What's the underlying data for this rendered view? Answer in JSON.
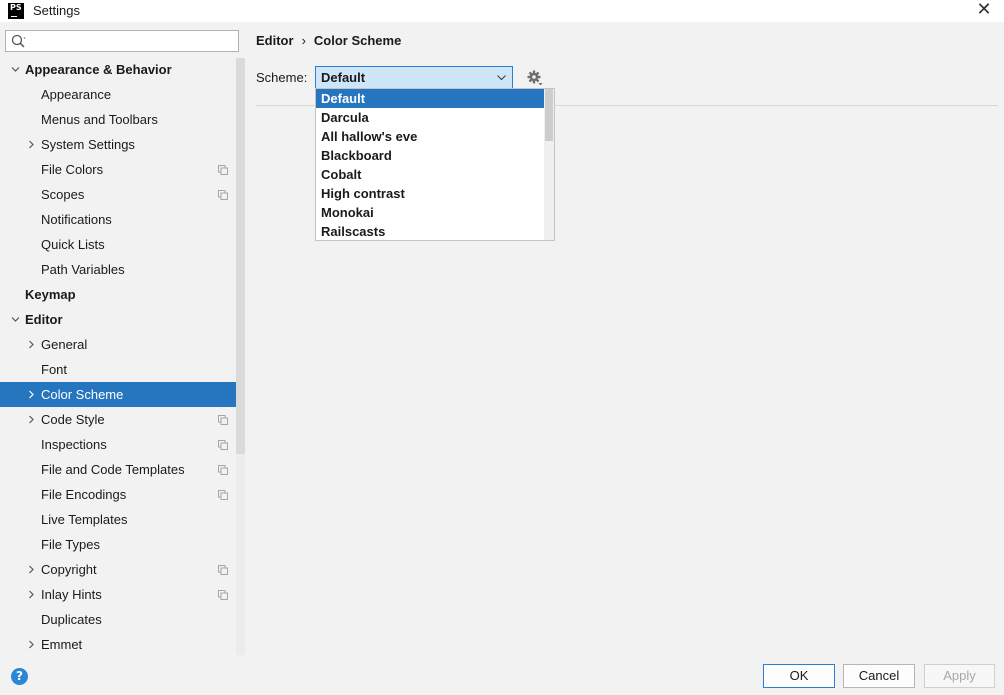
{
  "window": {
    "title": "Settings",
    "app_icon_text": "PS",
    "close_glyph": "✕"
  },
  "search": {
    "placeholder": "",
    "value": ""
  },
  "tree": [
    {
      "label": "Appearance & Behavior",
      "level": 0,
      "chevron": "down",
      "copy": false
    },
    {
      "label": "Appearance",
      "level": 1,
      "chevron": "",
      "copy": false
    },
    {
      "label": "Menus and Toolbars",
      "level": 1,
      "chevron": "",
      "copy": false
    },
    {
      "label": "System Settings",
      "level": 1,
      "chevron": "right",
      "copy": false
    },
    {
      "label": "File Colors",
      "level": 1,
      "chevron": "",
      "copy": true
    },
    {
      "label": "Scopes",
      "level": 1,
      "chevron": "",
      "copy": true
    },
    {
      "label": "Notifications",
      "level": 1,
      "chevron": "",
      "copy": false
    },
    {
      "label": "Quick Lists",
      "level": 1,
      "chevron": "",
      "copy": false
    },
    {
      "label": "Path Variables",
      "level": 1,
      "chevron": "",
      "copy": false
    },
    {
      "label": "Keymap",
      "level": 0,
      "chevron": "",
      "copy": false
    },
    {
      "label": "Editor",
      "level": 0,
      "chevron": "down",
      "copy": false
    },
    {
      "label": "General",
      "level": 1,
      "chevron": "right",
      "copy": false
    },
    {
      "label": "Font",
      "level": 1,
      "chevron": "",
      "copy": false
    },
    {
      "label": "Color Scheme",
      "level": 1,
      "chevron": "right",
      "copy": false,
      "selected": true
    },
    {
      "label": "Code Style",
      "level": 1,
      "chevron": "right",
      "copy": true
    },
    {
      "label": "Inspections",
      "level": 1,
      "chevron": "",
      "copy": true
    },
    {
      "label": "File and Code Templates",
      "level": 1,
      "chevron": "",
      "copy": true
    },
    {
      "label": "File Encodings",
      "level": 1,
      "chevron": "",
      "copy": true
    },
    {
      "label": "Live Templates",
      "level": 1,
      "chevron": "",
      "copy": false
    },
    {
      "label": "File Types",
      "level": 1,
      "chevron": "",
      "copy": false
    },
    {
      "label": "Copyright",
      "level": 1,
      "chevron": "right",
      "copy": true
    },
    {
      "label": "Inlay Hints",
      "level": 1,
      "chevron": "right",
      "copy": true
    },
    {
      "label": "Duplicates",
      "level": 1,
      "chevron": "",
      "copy": false
    },
    {
      "label": "Emmet",
      "level": 1,
      "chevron": "right",
      "copy": false
    }
  ],
  "breadcrumb": {
    "parent": "Editor",
    "separator": "›",
    "current": "Color Scheme"
  },
  "scheme": {
    "label": "Scheme:",
    "selected": "Default",
    "options": [
      "Default",
      "Darcula",
      "All hallow's eve",
      "Blackboard",
      "Cobalt",
      "High contrast",
      "Monokai",
      "Railscasts"
    ],
    "selected_index": 0
  },
  "footer": {
    "help_glyph": "?",
    "ok_label": "OK",
    "cancel_label": "Cancel",
    "apply_label": "Apply"
  },
  "colors": {
    "selection": "#2675bf",
    "combo_bg": "#cfe6f8",
    "accent_border": "#2b7fd1"
  }
}
